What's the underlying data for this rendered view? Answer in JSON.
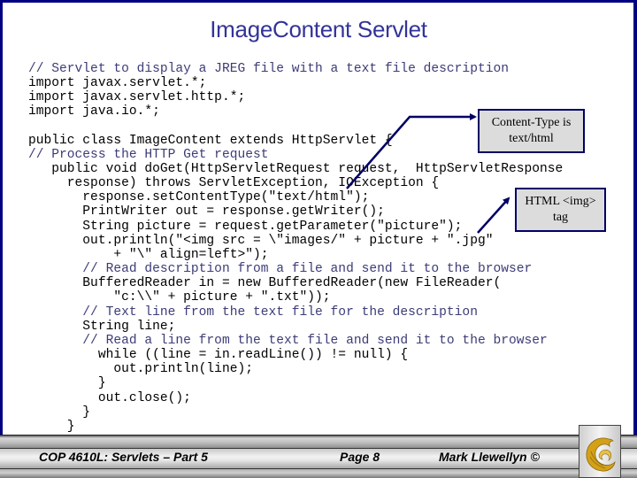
{
  "slide": {
    "title": "ImageContent Servlet",
    "code_lines": [
      {
        "text": "// Servlet to display a JREG file with a text file description",
        "comment": true
      },
      {
        "text": "import javax.servlet.*;",
        "comment": false
      },
      {
        "text": "import javax.servlet.http.*;",
        "comment": false
      },
      {
        "text": "import java.io.*;",
        "comment": false
      },
      {
        "text": "public class ImageContent extends HttpServlet {",
        "comment": false
      },
      {
        "text": "// Process the HTTP Get request",
        "comment": true
      },
      {
        "text": "   public void doGet(HttpServletRequest request,  HttpServletResponse",
        "comment": false
      },
      {
        "text": "     response) throws ServletException, IOException {",
        "comment": false
      },
      {
        "text": "       response.setContentType(\"text/html\");",
        "comment": false
      },
      {
        "text": "       PrintWriter out = response.getWriter();",
        "comment": false
      },
      {
        "text": "       String picture = request.getParameter(\"picture\");",
        "comment": false
      },
      {
        "text": "       out.println(\"<img src = \\\"images/\" + picture + \".jpg\"",
        "comment": false
      },
      {
        "text": "           + \"\\\" align=left>\");",
        "comment": false
      },
      {
        "text": "       // Read description from a file and send it to the browser",
        "comment": true
      },
      {
        "text": "       BufferedReader in = new BufferedReader(new FileReader(",
        "comment": false
      },
      {
        "text": "           \"c:\\\\\" + picture + \".txt\"));",
        "comment": false
      },
      {
        "text": "       // Text line from the text file for the description",
        "comment": true
      },
      {
        "text": "       String line;",
        "comment": false
      },
      {
        "text": "       // Read a line from the text file and send it to the browser",
        "comment": true
      },
      {
        "text": "         while ((line = in.readLine()) != null) {",
        "comment": false
      },
      {
        "text": "           out.println(line);",
        "comment": false
      },
      {
        "text": "         }",
        "comment": false
      },
      {
        "text": "         out.close();",
        "comment": false
      },
      {
        "text": "       }",
        "comment": false
      },
      {
        "text": "     }",
        "comment": false
      }
    ],
    "callouts": {
      "content_type": {
        "line1": "Content-Type is",
        "line2": "text/html"
      },
      "img_tag": {
        "line1": "HTML <img>",
        "line2": "tag"
      }
    }
  },
  "footer": {
    "course": "COP 4610L: Servlets – Part 5",
    "page": "Page 8",
    "author": "Mark Llewellyn ©"
  },
  "colors": {
    "border": "#000080",
    "title": "#333399",
    "comment": "#3c3c78",
    "callout_fill": "#dcdcdc",
    "callout_border": "#000066",
    "logo_gold": "#d4a017"
  }
}
